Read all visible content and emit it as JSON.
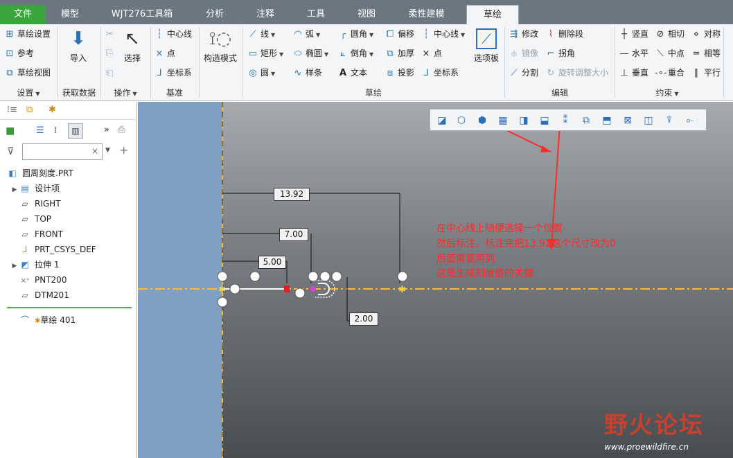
{
  "tabs": [
    {
      "label": "文件"
    },
    {
      "label": "模型"
    },
    {
      "label": "WJT276工具箱"
    },
    {
      "label": "分析"
    },
    {
      "label": "注释"
    },
    {
      "label": "工具"
    },
    {
      "label": "视图"
    },
    {
      "label": "柔性建模"
    },
    {
      "label": "草绘"
    }
  ],
  "ribbon": {
    "settings": {
      "items": [
        "草绘设置",
        "参考",
        "草绘视图"
      ],
      "group": "设置"
    },
    "getdata": {
      "import": "导入",
      "group": "获取数据"
    },
    "operations": {
      "select": "选择",
      "group": "操作"
    },
    "datum": {
      "items": [
        "中心线",
        "点",
        "坐标系"
      ],
      "group": "基准"
    },
    "construct": {
      "label": "构造模式"
    },
    "sketch": {
      "col1": [
        "线",
        "矩形",
        "圆"
      ],
      "col2": [
        "弧",
        "椭圆",
        "样条"
      ],
      "col3": [
        "圆角",
        "倒角",
        "文本"
      ],
      "col4": [
        "偏移",
        "加厚",
        "投影"
      ],
      "col5": [
        "中心线",
        "点",
        "坐标系"
      ],
      "palette": "选项板",
      "group": "草绘"
    },
    "edit": {
      "items": [
        "修改",
        "删除段",
        "镜像",
        "拐角",
        "分割",
        "旋转调整大小"
      ],
      "group": "编辑"
    },
    "constraint": {
      "items": [
        "竖直",
        "相切",
        "对称",
        "水平",
        "中点",
        "相等",
        "垂直",
        "重合",
        "平行"
      ],
      "group": "约束"
    }
  },
  "tree": {
    "search_placeholder": "",
    "items": [
      {
        "label": "圆周刻度.PRT",
        "icon": "part-icon"
      },
      {
        "label": "设计项",
        "icon": "design-items-icon"
      },
      {
        "label": "RIGHT",
        "icon": "datum-plane-icon"
      },
      {
        "label": "TOP",
        "icon": "datum-plane-icon"
      },
      {
        "label": "FRONT",
        "icon": "datum-plane-icon"
      },
      {
        "label": "PRT_CSYS_DEF",
        "icon": "csys-icon"
      },
      {
        "label": "拉伸 1",
        "icon": "extrude-icon"
      },
      {
        "label": "PNT200",
        "icon": "datum-point-icon"
      },
      {
        "label": "DTM201",
        "icon": "datum-plane-icon"
      },
      {
        "label": "草绘 401",
        "icon": "sketch-icon"
      }
    ]
  },
  "dimensions": [
    "13.92",
    "7.00",
    "5.00",
    "2.00"
  ],
  "annotation": [
    "在中心线上随便选择一个位置",
    "然后标注，标注完把13.92这个尺寸改为0",
    "后面需要用到",
    "这是生成刻度值的关键"
  ],
  "watermark": {
    "title": "野火论坛",
    "url": "www.proewildfire.cn"
  },
  "colors": {
    "file_tab": "#3aa53a",
    "annotation": "#ff2a2a",
    "centerline": "#f5b84a",
    "solid_face": "#7f9fc4"
  }
}
